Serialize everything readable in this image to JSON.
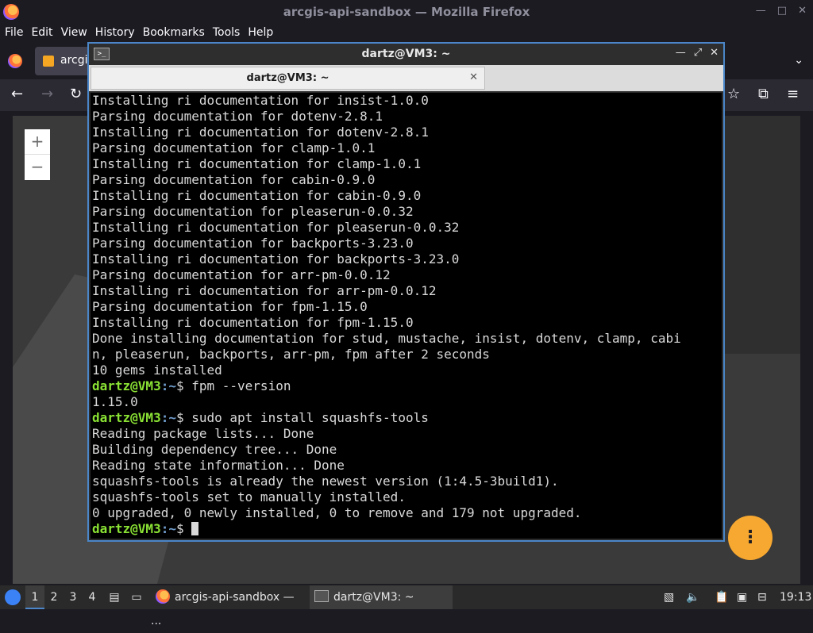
{
  "firefox": {
    "title": "arcgis-api-sandbox — Mozilla Firefox",
    "menu": [
      "File",
      "Edit",
      "View",
      "History",
      "Bookmarks",
      "Tools",
      "Help"
    ],
    "tab_label": "arcgi",
    "zoom_in": "+",
    "zoom_out": "−",
    "fab_label": "⋮"
  },
  "terminal": {
    "title": "dartz@VM3: ~",
    "tab_label": "dartz@VM3: ~",
    "prompt_user": "dartz@VM3",
    "prompt_path": ":~$ ",
    "lines": [
      {
        "text": "Installing ri documentation for insist-1.0.0"
      },
      {
        "text": "Parsing documentation for dotenv-2.8.1"
      },
      {
        "text": "Installing ri documentation for dotenv-2.8.1"
      },
      {
        "text": "Parsing documentation for clamp-1.0.1"
      },
      {
        "text": "Installing ri documentation for clamp-1.0.1"
      },
      {
        "text": "Parsing documentation for cabin-0.9.0"
      },
      {
        "text": "Installing ri documentation for cabin-0.9.0"
      },
      {
        "text": "Parsing documentation for pleaserun-0.0.32"
      },
      {
        "text": "Installing ri documentation for pleaserun-0.0.32"
      },
      {
        "text": "Parsing documentation for backports-3.23.0"
      },
      {
        "text": "Installing ri documentation for backports-3.23.0"
      },
      {
        "text": "Parsing documentation for arr-pm-0.0.12"
      },
      {
        "text": "Installing ri documentation for arr-pm-0.0.12"
      },
      {
        "text": "Parsing documentation for fpm-1.15.0"
      },
      {
        "text": "Installing ri documentation for fpm-1.15.0"
      },
      {
        "text": "Done installing documentation for stud, mustache, insist, dotenv, clamp, cabi"
      },
      {
        "text": "n, pleaserun, backports, arr-pm, fpm after 2 seconds"
      },
      {
        "text": "10 gems installed"
      },
      {
        "prompt": true,
        "text": "fpm --version"
      },
      {
        "text": "1.15.0"
      },
      {
        "prompt": true,
        "text": "sudo apt install squashfs-tools"
      },
      {
        "text": "Reading package lists... Done"
      },
      {
        "text": "Building dependency tree... Done"
      },
      {
        "text": "Reading state information... Done"
      },
      {
        "text": "squashfs-tools is already the newest version (1:4.5-3build1)."
      },
      {
        "text": "squashfs-tools set to manually installed."
      },
      {
        "text": "0 upgraded, 0 newly installed, 0 to remove and 179 not upgraded."
      },
      {
        "prompt": true,
        "text": "",
        "cursor": true
      }
    ]
  },
  "taskbar": {
    "workspaces": [
      "1",
      "2",
      "3",
      "4"
    ],
    "active_workspace": "1",
    "items": [
      {
        "label": "arcgis-api-sandbox — ..."
      },
      {
        "label": "dartz@VM3: ~"
      }
    ],
    "clock": "19:13"
  }
}
